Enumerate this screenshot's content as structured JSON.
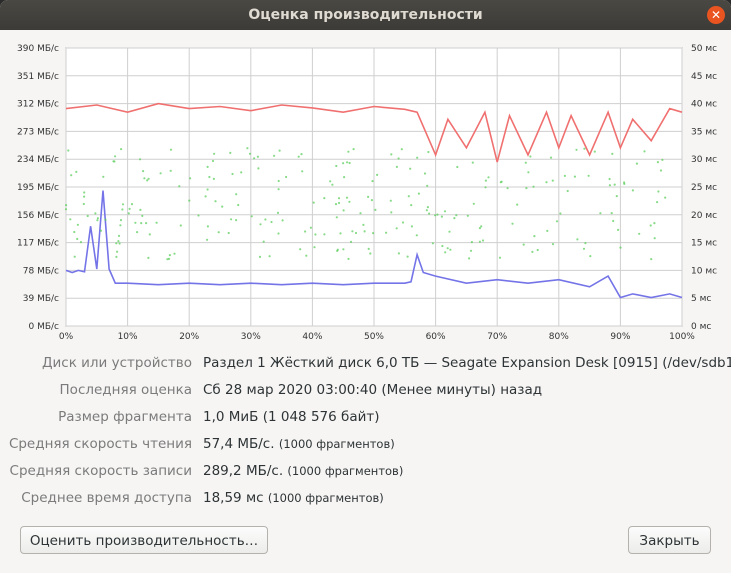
{
  "window": {
    "title": "Оценка производительности",
    "close_icon": "close-icon"
  },
  "chart_data": {
    "type": "line",
    "left_axis_ticks": [
      "390 МБ/с",
      "351 МБ/с",
      "312 МБ/с",
      "273 МБ/с",
      "234 МБ/с",
      "195 МБ/с",
      "156 МБ/с",
      "117 МБ/с",
      "78 МБ/с",
      "39 МБ/с",
      "0 МБ/с"
    ],
    "right_axis_ticks": [
      "50 мс",
      "45 мс",
      "40 мс",
      "35 мс",
      "30 мс",
      "25 мс",
      "20 мс",
      "15 мс",
      "10 мс",
      "5 мс",
      "0 мс"
    ],
    "x_ticks": [
      "0%",
      "10%",
      "20%",
      "30%",
      "40%",
      "50%",
      "60%",
      "70%",
      "80%",
      "90%",
      "100%"
    ],
    "ylim_left": [
      0,
      390
    ],
    "ylim_right": [
      0,
      50
    ],
    "xlim": [
      0,
      100
    ],
    "grid": true,
    "series": [
      {
        "color": "#f07070",
        "values_desc": "write",
        "x": [
          0,
          5,
          10,
          15,
          20,
          25,
          30,
          35,
          40,
          45,
          50,
          55,
          57,
          60,
          62,
          65,
          68,
          70,
          72,
          75,
          78,
          80,
          82,
          85,
          88,
          90,
          92,
          95,
          98,
          100
        ],
        "values": [
          305,
          310,
          300,
          312,
          305,
          308,
          302,
          310,
          306,
          300,
          308,
          304,
          300,
          240,
          290,
          250,
          300,
          230,
          295,
          240,
          300,
          250,
          295,
          240,
          300,
          250,
          290,
          260,
          305,
          300
        ]
      },
      {
        "color": "#7474e8",
        "values_desc": "read",
        "x": [
          0,
          1,
          2,
          3,
          4,
          5,
          6,
          7,
          8,
          10,
          15,
          20,
          25,
          30,
          35,
          40,
          45,
          50,
          55,
          56,
          57,
          58,
          60,
          65,
          70,
          75,
          80,
          85,
          88,
          90,
          92,
          95,
          98,
          100
        ],
        "values": [
          78,
          75,
          78,
          76,
          140,
          80,
          190,
          80,
          60,
          60,
          58,
          60,
          58,
          60,
          58,
          60,
          58,
          60,
          60,
          62,
          100,
          75,
          70,
          60,
          65,
          60,
          65,
          55,
          70,
          40,
          45,
          40,
          45,
          40
        ]
      },
      {
        "color": "#55cc55",
        "values_desc": "access",
        "x": [
          0,
          100
        ],
        "values": [
          20,
          20
        ]
      }
    ]
  },
  "info": {
    "device_label": "Диск или устройство",
    "device_value": "Раздел 1 Жёсткий диск 6,0 ТБ — Seagate Expansion Desk [0915] (/dev/sdb1)",
    "last_label": "Последняя оценка",
    "last_value": "Сб 28 мар 2020 03:00:40 (Менее минуты) назад",
    "chunk_label": "Размер фрагмента",
    "chunk_value": "1,0 МиБ (1 048 576 байт)",
    "read_label": "Средняя скорость чтения",
    "read_value": "57,4 МБ/с.",
    "read_note": "(1000 фрагментов)",
    "write_label": "Средняя скорость записи",
    "write_value": "289,2 МБ/с.",
    "write_note": "(1000 фрагментов)",
    "access_label": "Среднее время доступа",
    "access_value": "18,59 мс",
    "access_note": "(1000 фрагментов)"
  },
  "buttons": {
    "benchmark": "Оценить производительность…",
    "close": "Закрыть"
  }
}
